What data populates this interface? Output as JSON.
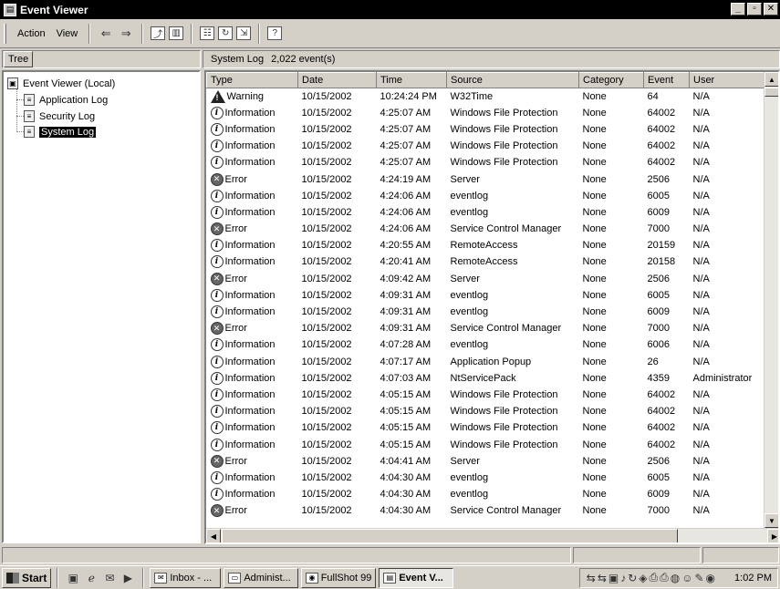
{
  "window": {
    "title": "Event Viewer",
    "min_glyph": "_",
    "max_glyph": "▫",
    "close_glyph": "✕"
  },
  "menu": {
    "action": "Action",
    "view": "View"
  },
  "tree": {
    "tab_label": "Tree",
    "root": "Event Viewer (Local)",
    "items": [
      {
        "label": "Application Log"
      },
      {
        "label": "Security Log"
      },
      {
        "label": "System Log"
      }
    ]
  },
  "list_header": {
    "log_name": "System Log",
    "count": "2,022 event(s)"
  },
  "columns": [
    "Type",
    "Date",
    "Time",
    "Source",
    "Category",
    "Event",
    "User"
  ],
  "events": [
    {
      "type": "Warning",
      "date": "10/15/2002",
      "time": "10:24:24 PM",
      "source": "W32Time",
      "category": "None",
      "event": "64",
      "user": "N/A"
    },
    {
      "type": "Information",
      "date": "10/15/2002",
      "time": "4:25:07 AM",
      "source": "Windows File Protection",
      "category": "None",
      "event": "64002",
      "user": "N/A"
    },
    {
      "type": "Information",
      "date": "10/15/2002",
      "time": "4:25:07 AM",
      "source": "Windows File Protection",
      "category": "None",
      "event": "64002",
      "user": "N/A"
    },
    {
      "type": "Information",
      "date": "10/15/2002",
      "time": "4:25:07 AM",
      "source": "Windows File Protection",
      "category": "None",
      "event": "64002",
      "user": "N/A"
    },
    {
      "type": "Information",
      "date": "10/15/2002",
      "time": "4:25:07 AM",
      "source": "Windows File Protection",
      "category": "None",
      "event": "64002",
      "user": "N/A"
    },
    {
      "type": "Error",
      "date": "10/15/2002",
      "time": "4:24:19 AM",
      "source": "Server",
      "category": "None",
      "event": "2506",
      "user": "N/A"
    },
    {
      "type": "Information",
      "date": "10/15/2002",
      "time": "4:24:06 AM",
      "source": "eventlog",
      "category": "None",
      "event": "6005",
      "user": "N/A"
    },
    {
      "type": "Information",
      "date": "10/15/2002",
      "time": "4:24:06 AM",
      "source": "eventlog",
      "category": "None",
      "event": "6009",
      "user": "N/A"
    },
    {
      "type": "Error",
      "date": "10/15/2002",
      "time": "4:24:06 AM",
      "source": "Service Control Manager",
      "category": "None",
      "event": "7000",
      "user": "N/A"
    },
    {
      "type": "Information",
      "date": "10/15/2002",
      "time": "4:20:55 AM",
      "source": "RemoteAccess",
      "category": "None",
      "event": "20159",
      "user": "N/A"
    },
    {
      "type": "Information",
      "date": "10/15/2002",
      "time": "4:20:41 AM",
      "source": "RemoteAccess",
      "category": "None",
      "event": "20158",
      "user": "N/A"
    },
    {
      "type": "Error",
      "date": "10/15/2002",
      "time": "4:09:42 AM",
      "source": "Server",
      "category": "None",
      "event": "2506",
      "user": "N/A"
    },
    {
      "type": "Information",
      "date": "10/15/2002",
      "time": "4:09:31 AM",
      "source": "eventlog",
      "category": "None",
      "event": "6005",
      "user": "N/A"
    },
    {
      "type": "Information",
      "date": "10/15/2002",
      "time": "4:09:31 AM",
      "source": "eventlog",
      "category": "None",
      "event": "6009",
      "user": "N/A"
    },
    {
      "type": "Error",
      "date": "10/15/2002",
      "time": "4:09:31 AM",
      "source": "Service Control Manager",
      "category": "None",
      "event": "7000",
      "user": "N/A"
    },
    {
      "type": "Information",
      "date": "10/15/2002",
      "time": "4:07:28 AM",
      "source": "eventlog",
      "category": "None",
      "event": "6006",
      "user": "N/A"
    },
    {
      "type": "Information",
      "date": "10/15/2002",
      "time": "4:07:17 AM",
      "source": "Application Popup",
      "category": "None",
      "event": "26",
      "user": "N/A"
    },
    {
      "type": "Information",
      "date": "10/15/2002",
      "time": "4:07:03 AM",
      "source": "NtServicePack",
      "category": "None",
      "event": "4359",
      "user": "Administrator"
    },
    {
      "type": "Information",
      "date": "10/15/2002",
      "time": "4:05:15 AM",
      "source": "Windows File Protection",
      "category": "None",
      "event": "64002",
      "user": "N/A"
    },
    {
      "type": "Information",
      "date": "10/15/2002",
      "time": "4:05:15 AM",
      "source": "Windows File Protection",
      "category": "None",
      "event": "64002",
      "user": "N/A"
    },
    {
      "type": "Information",
      "date": "10/15/2002",
      "time": "4:05:15 AM",
      "source": "Windows File Protection",
      "category": "None",
      "event": "64002",
      "user": "N/A"
    },
    {
      "type": "Information",
      "date": "10/15/2002",
      "time": "4:05:15 AM",
      "source": "Windows File Protection",
      "category": "None",
      "event": "64002",
      "user": "N/A"
    },
    {
      "type": "Error",
      "date": "10/15/2002",
      "time": "4:04:41 AM",
      "source": "Server",
      "category": "None",
      "event": "2506",
      "user": "N/A"
    },
    {
      "type": "Information",
      "date": "10/15/2002",
      "time": "4:04:30 AM",
      "source": "eventlog",
      "category": "None",
      "event": "6005",
      "user": "N/A"
    },
    {
      "type": "Information",
      "date": "10/15/2002",
      "time": "4:04:30 AM",
      "source": "eventlog",
      "category": "None",
      "event": "6009",
      "user": "N/A"
    },
    {
      "type": "Error",
      "date": "10/15/2002",
      "time": "4:04:30 AM",
      "source": "Service Control Manager",
      "category": "None",
      "event": "7000",
      "user": "N/A"
    }
  ],
  "taskbar": {
    "start_label": "Start",
    "tasks": [
      {
        "label": "Inbox - ...",
        "icon": "inbox-icon"
      },
      {
        "label": "Administ...",
        "icon": "console-icon"
      },
      {
        "label": "FullShot 99",
        "icon": "camera-icon"
      },
      {
        "label": "Event V...",
        "icon": "event-viewer-icon",
        "active": true
      }
    ],
    "clock": "1:02 PM"
  },
  "colors": {
    "titlebar": "#000000",
    "chrome": "#d4d0c8",
    "selection": "#000000"
  }
}
